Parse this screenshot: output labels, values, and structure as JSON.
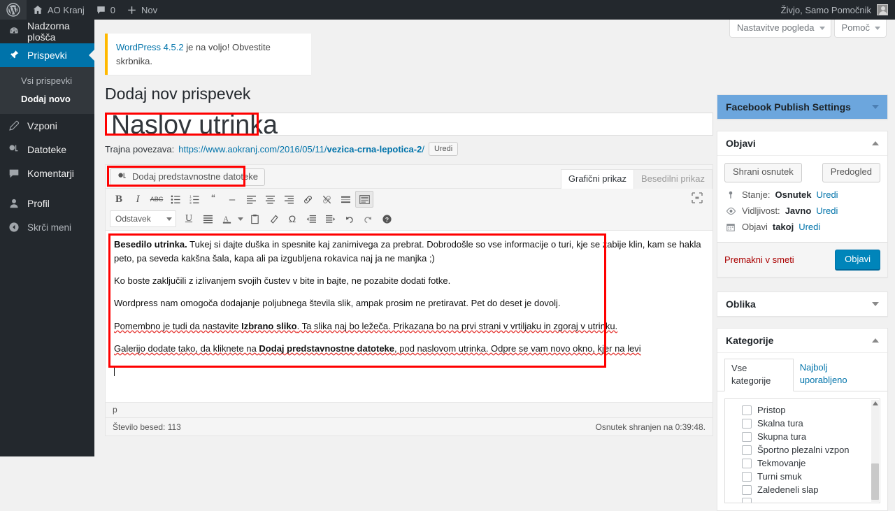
{
  "adminbar": {
    "logo_icon": "wordpress-logo-icon",
    "site_icon": "home-icon",
    "site_name": "AO Kranj",
    "comments_icon": "comment-bubble-icon",
    "comments_count": "0",
    "new_icon": "plus-icon",
    "new_label": "Nov",
    "howdy": "Živjo, Samo Pomočnik",
    "avatar_icon": "user-avatar-icon"
  },
  "sidebar": {
    "items": [
      {
        "label": "Nadzorna plošča",
        "icon": "dashboard-icon",
        "current": false
      },
      {
        "label": "Prispevki",
        "icon": "pin-icon",
        "current": true
      },
      {
        "label": "Vzponi",
        "icon": "pushpin-tool-icon",
        "current": false
      },
      {
        "label": "Datoteke",
        "icon": "media-icon",
        "current": false
      },
      {
        "label": "Komentarji",
        "icon": "comment-bubble-icon",
        "current": false
      },
      {
        "label": "Profil",
        "icon": "user-icon",
        "current": false
      }
    ],
    "submenu": [
      {
        "label": "Vsi prispevki",
        "current": false
      },
      {
        "label": "Dodaj novo",
        "current": true
      }
    ],
    "collapse": {
      "label": "Skrči meni",
      "icon": "collapse-arrow-icon"
    }
  },
  "screen_meta": {
    "screen_options": "Nastavitve pogleda",
    "help": "Pomoč"
  },
  "notice": {
    "link_text": "WordPress 4.5.2",
    "rest_text": " je na voljo! Obvestite skrbnika."
  },
  "page": {
    "title": "Dodaj nov prispevek"
  },
  "post": {
    "title_value": "Naslov utrinka",
    "title_placeholder": "Vnesite naslov",
    "permalink_label": "Trajna povezava:",
    "permalink_url_prefix": "https://www.aokranj.com/2016/05/11/",
    "permalink_slug": "vezica-crna-lepotica-2",
    "permalink_url_suffix": "/",
    "permalink_edit": "Uredi"
  },
  "editor": {
    "insert_media": "Dodaj predstavnostne datoteke",
    "insert_media_icon": "media-add-icon",
    "tabs": [
      {
        "label": "Grafični prikaz",
        "active": true
      },
      {
        "label": "Besedilni prikaz",
        "active": false
      }
    ],
    "toolbar_row1": [
      {
        "icon": "bold-icon",
        "glyph": "B",
        "active": false
      },
      {
        "icon": "italic-icon",
        "glyph": "I",
        "active": false
      },
      {
        "icon": "strikethrough-icon",
        "glyph": "ABC",
        "active": false
      },
      {
        "icon": "bullet-list-icon",
        "glyph": "",
        "active": false
      },
      {
        "icon": "numbered-list-icon",
        "glyph": "",
        "active": false
      },
      {
        "icon": "blockquote-icon",
        "glyph": "“",
        "active": false
      },
      {
        "icon": "horizontal-rule-icon",
        "glyph": "–",
        "active": false
      },
      {
        "icon": "align-left-icon",
        "glyph": "",
        "active": false
      },
      {
        "icon": "align-center-icon",
        "glyph": "",
        "active": false
      },
      {
        "icon": "align-right-icon",
        "glyph": "",
        "active": false
      },
      {
        "icon": "insert-link-icon",
        "glyph": "",
        "active": false
      },
      {
        "icon": "unlink-icon",
        "glyph": "",
        "active": false
      },
      {
        "icon": "read-more-icon",
        "glyph": "",
        "active": false
      },
      {
        "icon": "toggle-toolbar-icon",
        "glyph": "",
        "active": true
      }
    ],
    "format_select": "Odstavek",
    "toolbar_row2": [
      {
        "icon": "underline-icon",
        "glyph": "U"
      },
      {
        "icon": "justify-icon",
        "glyph": ""
      },
      {
        "icon": "text-color-icon",
        "glyph": "A"
      },
      {
        "icon": "paste-as-text-icon",
        "glyph": ""
      },
      {
        "icon": "clear-formatting-icon",
        "glyph": ""
      },
      {
        "icon": "special-character-icon",
        "glyph": "Ω"
      },
      {
        "icon": "outdent-icon",
        "glyph": ""
      },
      {
        "icon": "indent-icon",
        "glyph": ""
      },
      {
        "icon": "undo-icon",
        "glyph": ""
      },
      {
        "icon": "redo-icon",
        "glyph": ""
      },
      {
        "icon": "keyboard-shortcuts-icon",
        "glyph": "?"
      }
    ],
    "fullscreen_icon": "distraction-free-icon",
    "paragraphs": [
      {
        "lead": "Besedilo utrinka.",
        "text": " Tukej si dajte duška in spesnite kaj zanimivega za prebrat. Dobrodošle so vse informacije o turi, kje se zabije klin, kam se hakla peto, pa seveda kakšna šala, kapa ali pa izgubljena rokavica naj ja ne manjka ;)",
        "spellcheck": false
      },
      {
        "lead": "",
        "text": "Ko boste zaključili z izlivanjem svojih čustev v bite in bajte, ne pozabite dodati fotke.",
        "spellcheck": false
      },
      {
        "lead": "",
        "text": "Wordpress nam omogoča dodajanje poljubnega števila slik, ampak prosim ne pretiravat. Pet do deset je dovolj.",
        "spellcheck": false
      },
      {
        "lead": "",
        "text": "Pomembno je tudi da nastavite ",
        "bold": "Izbrano sliko",
        "text2": ". Ta slika naj bo ležeča. Prikazana bo na prvi strani v vrtiljaku in zgoraj v utrinku.",
        "spellcheck": true
      },
      {
        "lead": "",
        "text": "Galerijo dodate tako, da kliknete na ",
        "bold": "Dodaj predstavnostne datoteke",
        "text2": ", pod naslovom utrinka. Odpre se vam novo okno, kjer na levi",
        "spellcheck": true
      }
    ],
    "path": "p",
    "word_count": "Število besed: 113",
    "autosave": "Osnutek shranjen na 0:39:48."
  },
  "facebook_box": {
    "title": "Facebook Publish Settings",
    "accent": "#6ca6dd"
  },
  "publish_box": {
    "title": "Objavi",
    "save_draft": "Shrani osnutek",
    "preview": "Predogled",
    "status_icon": "pin-status-icon",
    "status_label": "Stanje:",
    "status_value": "Osnutek",
    "status_edit": "Uredi",
    "visibility_icon": "eye-icon",
    "visibility_label": "Vidljivost:",
    "visibility_value": "Javno",
    "visibility_edit": "Uredi",
    "schedule_icon": "calendar-icon",
    "schedule_label": "Objavi",
    "schedule_value": "takoj",
    "schedule_edit": "Uredi",
    "trash": "Premakni v smeti",
    "publish": "Objavi",
    "publish_color": "#0085ba"
  },
  "format_box": {
    "title": "Oblika"
  },
  "categories_box": {
    "title": "Kategorije",
    "tabs": [
      {
        "label": "Vse kategorije",
        "active": true
      },
      {
        "label": "Najbolj uporabljeno",
        "active": false
      }
    ],
    "items": [
      {
        "label": "Pristop",
        "checked": false
      },
      {
        "label": "Skalna tura",
        "checked": false
      },
      {
        "label": "Skupna tura",
        "checked": false
      },
      {
        "label": "Športno plezalni vzpon",
        "checked": false
      },
      {
        "label": "Tekmovanje",
        "checked": false
      },
      {
        "label": "Turni smuk",
        "checked": false
      },
      {
        "label": "Zaledeneli slap",
        "checked": false
      },
      {
        "label": "",
        "checked": false
      }
    ]
  },
  "highlights": {
    "color": "#ff0000",
    "regions": [
      "post-title",
      "insert-media-button",
      "editor-content"
    ]
  }
}
